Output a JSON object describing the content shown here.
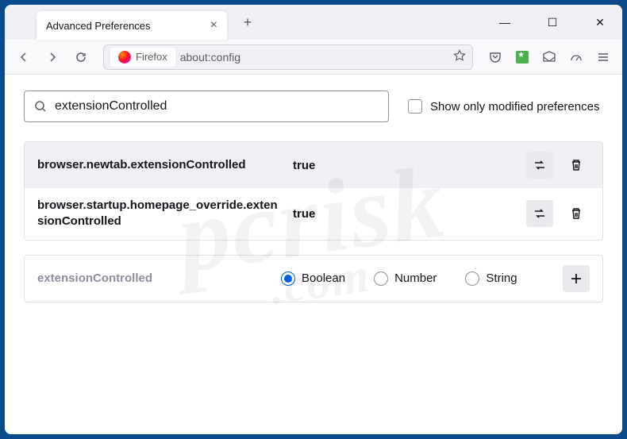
{
  "tab": {
    "title": "Advanced Preferences"
  },
  "urlbar": {
    "identity": "Firefox",
    "url": "about:config"
  },
  "search": {
    "value": "extensionControlled"
  },
  "checkbox": {
    "label": "Show only modified preferences"
  },
  "prefs": [
    {
      "name": "browser.newtab.extensionControlled",
      "value": "true"
    },
    {
      "name": "browser.startup.homepage_override.extensionControlled",
      "value": "true"
    }
  ],
  "newpref": {
    "name": "extensionControlled",
    "types": [
      "Boolean",
      "Number",
      "String"
    ],
    "selected": "Boolean"
  },
  "watermark": {
    "main": "pcrisk",
    "sub": ".com"
  }
}
